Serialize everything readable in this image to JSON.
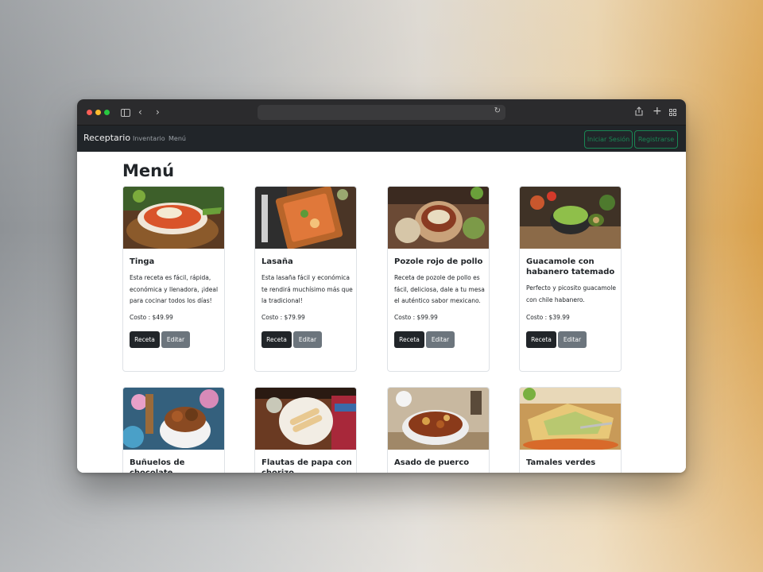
{
  "browser": {
    "url": ""
  },
  "navbar": {
    "brand": "Receptario",
    "links": [
      "Inventario",
      "Menú"
    ],
    "login_label": "Iniciar Sesión",
    "register_label": "Registrarse",
    "accent": "#198754"
  },
  "page": {
    "title": "Menú"
  },
  "cards": [
    {
      "title": "Tinga",
      "description": "Esta receta es fácil, rápida, económica y llenadora, ¡ideal para cocinar todos los días!",
      "cost": "Costo : $49.99",
      "receta_label": "Receta",
      "editar_label": "Editar"
    },
    {
      "title": "Lasaña",
      "description": "Esta lasaña fácil y económica te rendirá muchísimo más que la tradicional!",
      "cost": "Costo : $79.99",
      "receta_label": "Receta",
      "editar_label": "Editar"
    },
    {
      "title": "Pozole rojo de pollo",
      "description": "Receta de pozole de pollo es fácil, deliciosa, dale a tu mesa el auténtico sabor mexicano.",
      "cost": "Costo : $99.99",
      "receta_label": "Receta",
      "editar_label": "Editar"
    },
    {
      "title": "Guacamole con habanero tatemado",
      "description": "Perfecto y picosito guacamole con chile habanero.",
      "cost": "Costo : $39.99",
      "receta_label": "Receta",
      "editar_label": "Editar"
    },
    {
      "title": "Buñuelos de chocolate"
    },
    {
      "title": "Flautas de papa con chorizo"
    },
    {
      "title": "Asado de puerco"
    },
    {
      "title": "Tamales verdes"
    }
  ]
}
